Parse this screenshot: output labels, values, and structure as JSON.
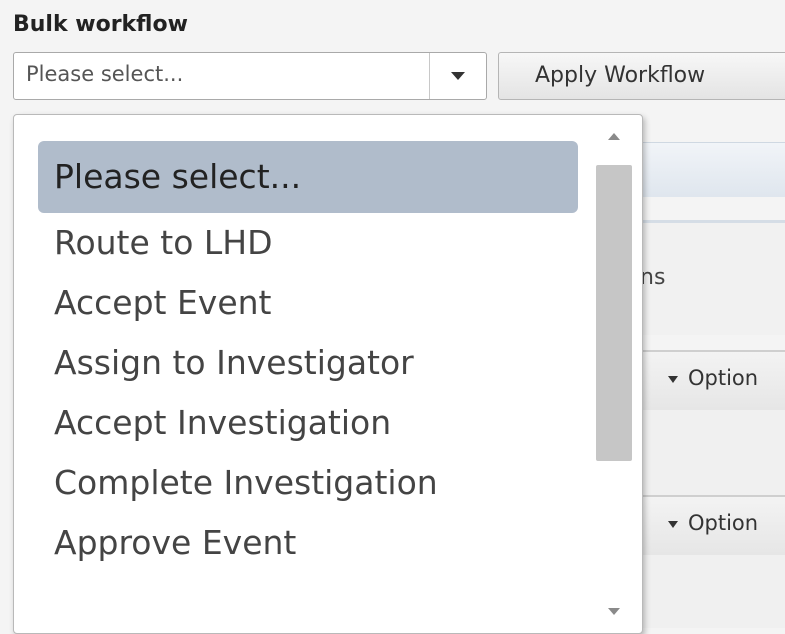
{
  "section": {
    "title": "Bulk workflow"
  },
  "workflow_select": {
    "value": "Please select..."
  },
  "apply_button": {
    "label": "Apply Workflow"
  },
  "background": {
    "partial_text": "ns",
    "option_label_1": "Option",
    "option_label_2": "Option"
  },
  "dropdown": {
    "items": [
      "Please select...",
      "Route to LHD",
      "Accept Event",
      "Assign to Investigator",
      "Accept Investigation",
      "Complete Investigation",
      "Approve Event"
    ],
    "selected_index": 0
  },
  "colors": {
    "selected_bg": "#b0bccb",
    "page_bg": "#f4f4f4"
  }
}
